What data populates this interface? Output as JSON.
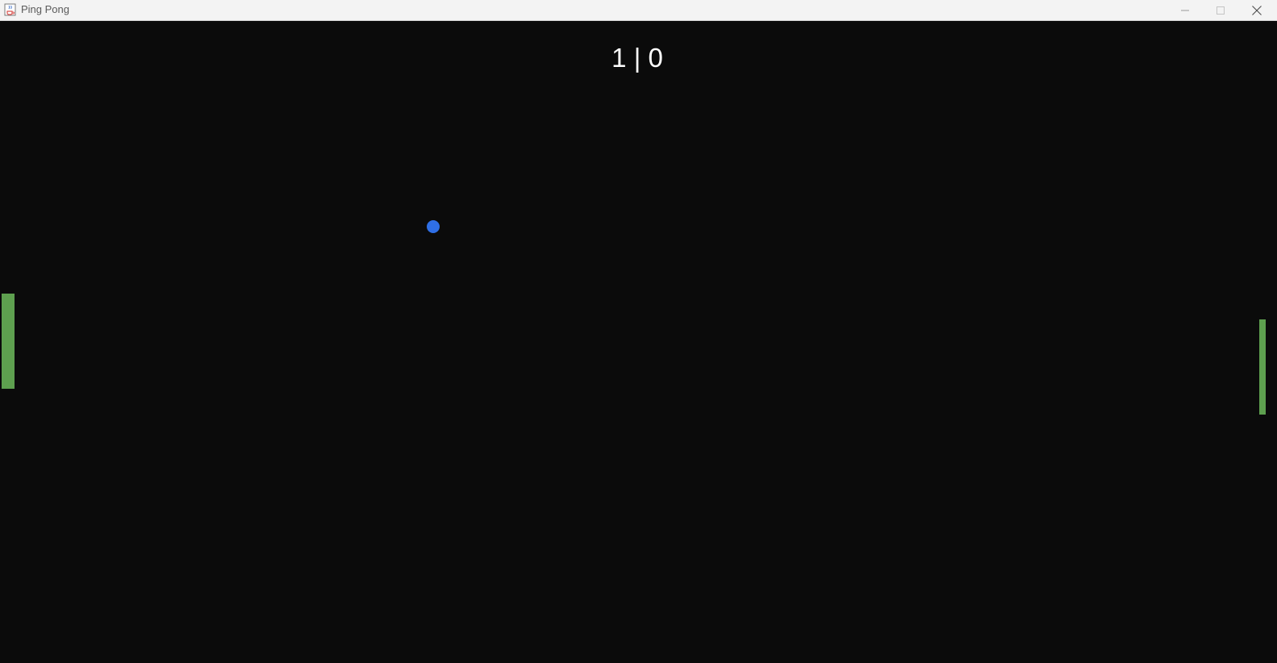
{
  "window": {
    "title": "Ping Pong",
    "app_icon": "java-cup-icon",
    "controls": [
      "minimize-icon",
      "maximize-icon",
      "close-icon"
    ]
  },
  "game": {
    "score_left": "1",
    "separator": "|",
    "score_right": "0",
    "background_color": "#0b0b0b",
    "paddle_color": "#5ea04f",
    "ball_color": "#2f6fe6",
    "score_color": "#ffffff"
  }
}
